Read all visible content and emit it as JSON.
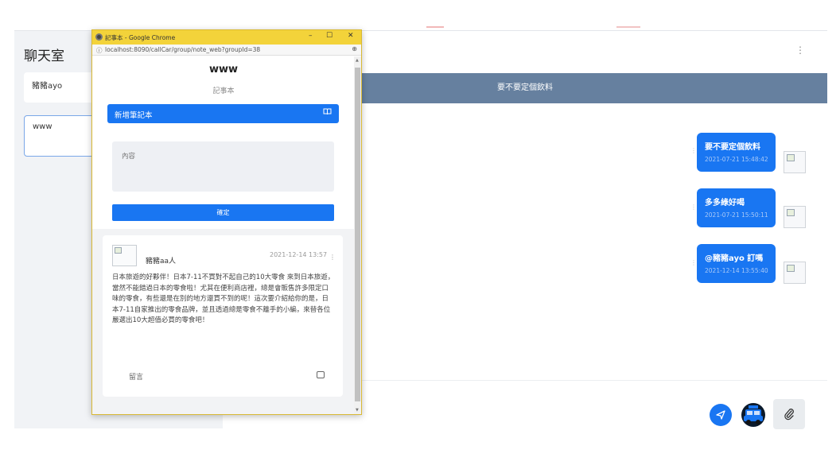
{
  "sidebar": {
    "title": "聊天室",
    "rooms": [
      {
        "name": "豬豬ayo"
      },
      {
        "name": "www"
      }
    ]
  },
  "chat": {
    "header_menu": "⋮",
    "pinned": "要不要定個飲料",
    "messages": [
      {
        "text": "要不要定個飲料",
        "time": "2021-07-21 15:48:42"
      },
      {
        "text": "多多綠好喝",
        "time": "2021-07-21 15:50:11"
      },
      {
        "text": "@豬豬ayo 訂嗎",
        "time": "2021-12-14 13:55:40"
      }
    ],
    "send_icon": "send-icon",
    "taxi_icon": "taxi-icon",
    "attach_icon": "paperclip-icon",
    "colors": {
      "accent": "#1976f2",
      "pinned_bg": "#66809f"
    }
  },
  "popup": {
    "window_title": "記事本 - Google Chrome",
    "url": "localhost:8090/callCar/group/note_web?groupId=38",
    "controls": {
      "minimize": "–",
      "maximize": "☐",
      "close": "✕"
    },
    "heading": "www",
    "subheading": "記事本",
    "new_note_label": "新增筆記本",
    "content_placeholder": "內容",
    "confirm_label": "確定",
    "post": {
      "author": "豬豬aa人",
      "time": "2021-12-14 13:57",
      "body": "日本旅遊的好夥伴！日本7-11不買對不起自己的10大零食 來到日本旅遊，當然不能錯過日本的零食啦！尤其在便利商店裡，總是會販售許多限定口味的零食，有些還是在別的地方還買不到的呢！這次要介紹給你的是，日本7-11自家推出的零食品牌，並且透過總是零食不離手的小編，來替各位嚴選出10大超值必買的零食吧！",
      "comment_label": "留言"
    }
  }
}
